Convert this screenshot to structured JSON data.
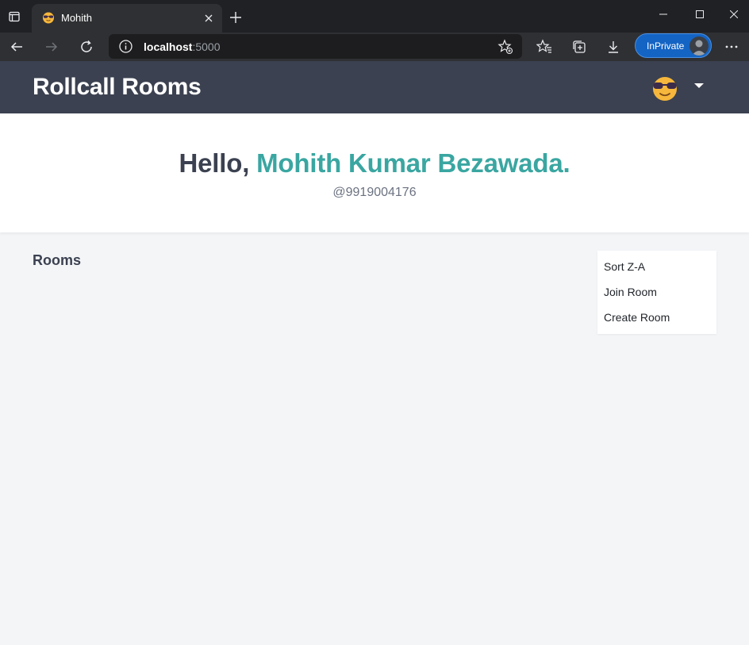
{
  "browser": {
    "tab_title": "Mohith",
    "url_host": "localhost",
    "url_port": ":5000",
    "inprivate_label": "InPrivate"
  },
  "header": {
    "brand": "Rollcall Rooms",
    "avatar_icon": "sunglasses-emoji-icon"
  },
  "hero": {
    "greeting_prefix": "Hello, ",
    "user_name": "Mohith Kumar Bezawada.",
    "username_handle": "@9919004176"
  },
  "rooms": {
    "title": "Rooms",
    "menu": [
      "Sort Z-A",
      "Join Room",
      "Create Room"
    ]
  },
  "colors": {
    "header_bg": "#3b4150",
    "accent": "#3aa6a1",
    "page_bg": "#f3f5f7"
  }
}
